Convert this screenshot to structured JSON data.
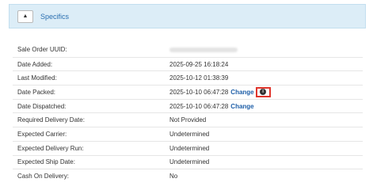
{
  "panel": {
    "toggle_icon": "▲",
    "title": "Specifics"
  },
  "details": {
    "sale_order_uuid_label": "Sale Order UUID:",
    "date_added_label": "Date Added:",
    "date_added_value": "2025-09-25 16:18:24",
    "last_modified_label": "Last Modified:",
    "last_modified_value": "2025-10-12 01:38:39",
    "date_packed_label": "Date Packed:",
    "date_packed_value": "2025-10-10 06:47:28",
    "date_packed_change": "Change",
    "info_icon": "i",
    "date_dispatched_label": "Date Dispatched:",
    "date_dispatched_value": "2025-10-10 06:47:28",
    "date_dispatched_change": "Change",
    "required_delivery_label": "Required Delivery Date:",
    "required_delivery_value": "Not Provided",
    "expected_carrier_label": "Expected Carrier:",
    "expected_carrier_value": "Undetermined",
    "expected_delivery_run_label": "Expected Delivery Run:",
    "expected_delivery_run_value": "Undetermined",
    "expected_ship_date_label": "Expected Ship Date:",
    "expected_ship_date_value": "Undetermined",
    "cash_on_delivery_label": "Cash On Delivery:",
    "cash_on_delivery_value": "No"
  },
  "colors": {
    "header_bg": "#dcedf7",
    "link": "#1f5fa8",
    "highlight": "#e0352c"
  }
}
